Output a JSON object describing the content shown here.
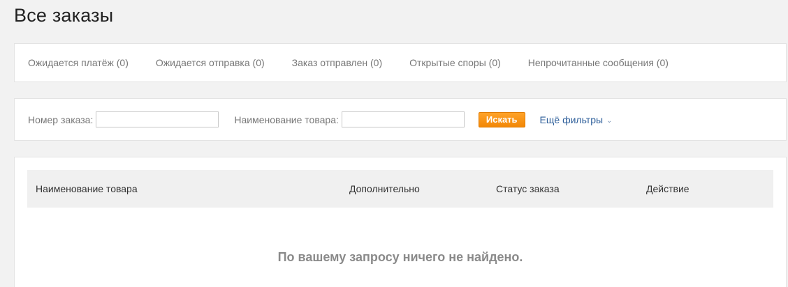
{
  "page": {
    "title": "Все заказы"
  },
  "status_tabs": [
    {
      "label": "Ожидается платёж (0)"
    },
    {
      "label": "Ожидается отправка (0)"
    },
    {
      "label": "Заказ отправлен (0)"
    },
    {
      "label": "Открытые споры (0)"
    },
    {
      "label": "Непрочитанные сообщения (0)"
    }
  ],
  "filters": {
    "order_number_label": "Номер заказа:",
    "order_number_value": "",
    "product_name_label": "Наименование товара:",
    "product_name_value": "",
    "search_button": "Искать",
    "more_filters": "Ещё фильтры",
    "more_filters_icon": "chevron-down-icon"
  },
  "table": {
    "columns": [
      "Наименование товара",
      "Дополнительно",
      "Статус заказа",
      "Действие"
    ],
    "rows": [],
    "empty_message": "По вашему запросу ничего не найдено."
  },
  "colors": {
    "accent": "#f28706",
    "link": "#2d5e9a",
    "background": "#f2f2f2"
  }
}
